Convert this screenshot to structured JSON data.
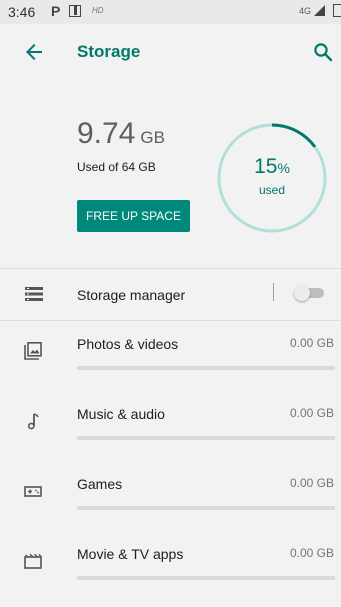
{
  "status_bar": {
    "time": "3:46",
    "notification_letter": "P",
    "hd_label": "HD",
    "network": "4G"
  },
  "app_bar": {
    "title": "Storage",
    "back_icon": "arrow-back-icon",
    "search_icon": "search-icon"
  },
  "summary": {
    "used_value": "9.74",
    "used_unit": "GB",
    "used_of_text": "Used of 64 GB",
    "free_up_button_label": "FREE UP SPACE",
    "percent_value": "15",
    "percent_sign": "%",
    "percent_label": "used",
    "percent_used_fraction": 0.15
  },
  "storage_manager": {
    "label": "Storage manager",
    "icon": "storage-manager-icon",
    "enabled": false
  },
  "categories": [
    {
      "label": "Photos & videos",
      "size": "0.00 GB",
      "icon": "image-icon",
      "fill_fraction": 0
    },
    {
      "label": "Music & audio",
      "size": "0.00 GB",
      "icon": "music-note-icon",
      "fill_fraction": 0
    },
    {
      "label": "Games",
      "size": "0.00 GB",
      "icon": "gamepad-icon",
      "fill_fraction": 0
    },
    {
      "label": "Movie & TV apps",
      "size": "0.00 GB",
      "icon": "movie-icon",
      "fill_fraction": 0
    }
  ],
  "colors": {
    "accent": "#00796b",
    "button": "#00897b",
    "ring_track": "#b2dfdb",
    "ring_progress": "#00796b"
  }
}
